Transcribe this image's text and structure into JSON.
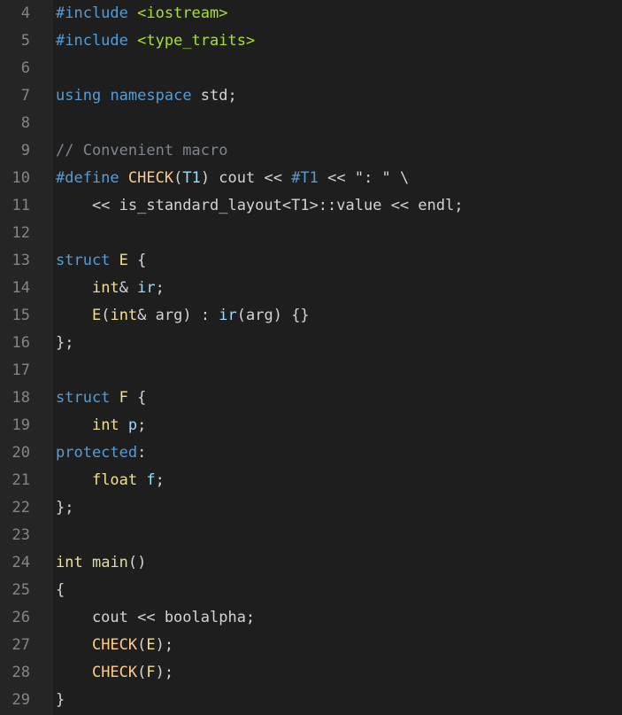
{
  "colors": {
    "background": "#1e1e1e",
    "gutter": "#252526",
    "line_number": "#858585",
    "default": "#d4d4d4",
    "keyword": "#569cd6",
    "preprocessor": "#569cd6",
    "string": "#a6e22e",
    "comment": "#7f848e",
    "type": "#f2e08f",
    "macro": "#ffcb8b",
    "function": "#dcdcaa",
    "identifier": "#9cdcfe"
  },
  "lines": [
    {
      "n": "4",
      "tokens": [
        [
          "#include",
          "preprocessor"
        ],
        [
          " ",
          "default"
        ],
        [
          "<iostream>",
          "string"
        ]
      ]
    },
    {
      "n": "5",
      "tokens": [
        [
          "#include",
          "preprocessor"
        ],
        [
          " ",
          "default"
        ],
        [
          "<type_traits>",
          "string"
        ]
      ]
    },
    {
      "n": "6",
      "tokens": []
    },
    {
      "n": "7",
      "tokens": [
        [
          "using",
          "keyword"
        ],
        [
          " ",
          "default"
        ],
        [
          "namespace",
          "keyword"
        ],
        [
          " std;",
          "default"
        ]
      ]
    },
    {
      "n": "8",
      "tokens": []
    },
    {
      "n": "9",
      "tokens": [
        [
          "// Convenient macro",
          "comment"
        ]
      ]
    },
    {
      "n": "10",
      "tokens": [
        [
          "#define",
          "preprocessor"
        ],
        [
          " ",
          "default"
        ],
        [
          "CHECK",
          "macro"
        ],
        [
          "(",
          "default"
        ],
        [
          "T1",
          "identifier"
        ],
        [
          ") cout << ",
          "default"
        ],
        [
          "#T1",
          "preprocessor"
        ],
        [
          " << \": \" \\",
          "default"
        ]
      ]
    },
    {
      "n": "11",
      "tokens": [
        [
          "    << is_standard_layout<T1>::value << endl;",
          "default"
        ]
      ]
    },
    {
      "n": "12",
      "tokens": []
    },
    {
      "n": "13",
      "tokens": [
        [
          "struct",
          "keyword"
        ],
        [
          " ",
          "default"
        ],
        [
          "E",
          "type"
        ],
        [
          " {",
          "default"
        ]
      ]
    },
    {
      "n": "14",
      "tokens": [
        [
          "    ",
          "default"
        ],
        [
          "int",
          "type"
        ],
        [
          "& ",
          "default"
        ],
        [
          "ir",
          "identifier"
        ],
        [
          ";",
          "default"
        ]
      ]
    },
    {
      "n": "15",
      "tokens": [
        [
          "    ",
          "default"
        ],
        [
          "E",
          "type"
        ],
        [
          "(",
          "default"
        ],
        [
          "int",
          "type"
        ],
        [
          "& arg) : ",
          "default"
        ],
        [
          "ir",
          "identifier"
        ],
        [
          "(arg) {}",
          "default"
        ]
      ]
    },
    {
      "n": "16",
      "tokens": [
        [
          "};",
          "default"
        ]
      ]
    },
    {
      "n": "17",
      "tokens": []
    },
    {
      "n": "18",
      "tokens": [
        [
          "struct",
          "keyword"
        ],
        [
          " ",
          "default"
        ],
        [
          "F",
          "type"
        ],
        [
          " {",
          "default"
        ]
      ]
    },
    {
      "n": "19",
      "tokens": [
        [
          "    ",
          "default"
        ],
        [
          "int",
          "type"
        ],
        [
          " ",
          "default"
        ],
        [
          "p",
          "identifier"
        ],
        [
          ";",
          "default"
        ]
      ]
    },
    {
      "n": "20",
      "tokens": [
        [
          "protected",
          "keyword"
        ],
        [
          ":",
          "default"
        ]
      ]
    },
    {
      "n": "21",
      "tokens": [
        [
          "    ",
          "default"
        ],
        [
          "float",
          "type"
        ],
        [
          " ",
          "default"
        ],
        [
          "f",
          "identifier"
        ],
        [
          ";",
          "default"
        ]
      ]
    },
    {
      "n": "22",
      "tokens": [
        [
          "};",
          "default"
        ]
      ]
    },
    {
      "n": "23",
      "tokens": []
    },
    {
      "n": "24",
      "tokens": [
        [
          "int",
          "type"
        ],
        [
          " ",
          "default"
        ],
        [
          "main",
          "function"
        ],
        [
          "()",
          "default"
        ]
      ]
    },
    {
      "n": "25",
      "tokens": [
        [
          "{",
          "default"
        ]
      ]
    },
    {
      "n": "26",
      "tokens": [
        [
          "    cout << boolalpha;",
          "default"
        ]
      ]
    },
    {
      "n": "27",
      "tokens": [
        [
          "    ",
          "default"
        ],
        [
          "CHECK",
          "macro"
        ],
        [
          "(",
          "default"
        ],
        [
          "E",
          "type"
        ],
        [
          ");",
          "default"
        ]
      ]
    },
    {
      "n": "28",
      "tokens": [
        [
          "    ",
          "default"
        ],
        [
          "CHECK",
          "macro"
        ],
        [
          "(",
          "default"
        ],
        [
          "F",
          "type"
        ],
        [
          ");",
          "default"
        ]
      ]
    },
    {
      "n": "29",
      "tokens": [
        [
          "}",
          "default"
        ]
      ]
    }
  ]
}
